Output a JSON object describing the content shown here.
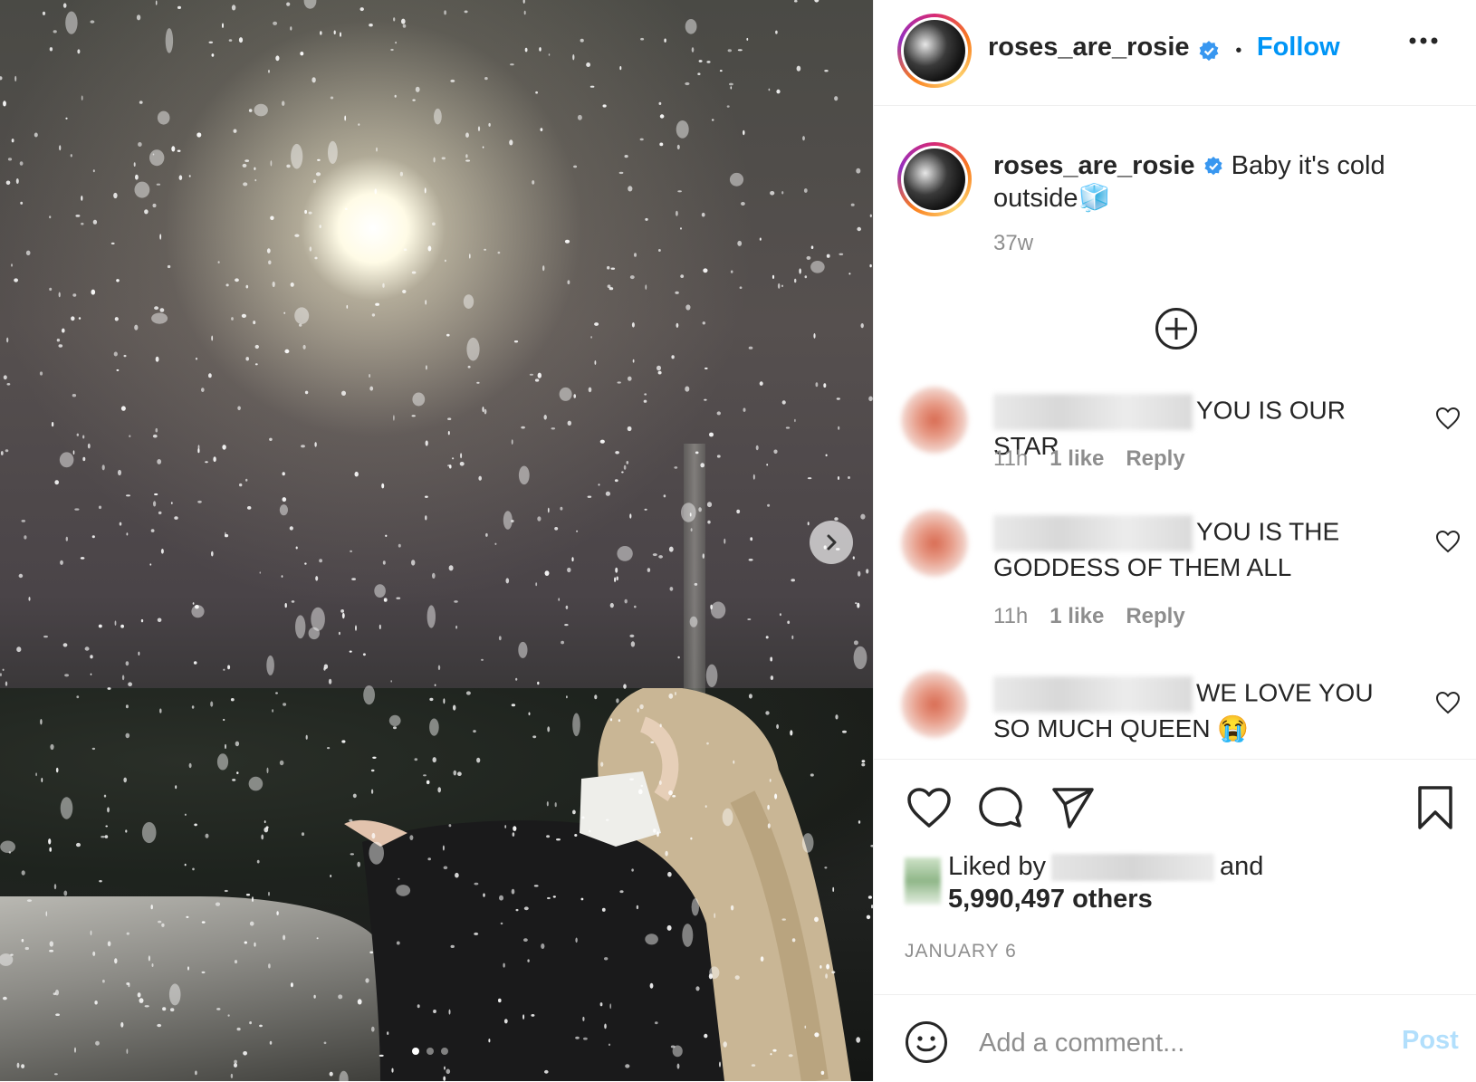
{
  "post": {
    "username": "roses_are_rosie",
    "follow_label": "Follow",
    "dot_separator": "•",
    "caption_line1": "Baby it's cold",
    "caption_line2": "outside",
    "caption_emoji": "🧊",
    "time_ago": "37w"
  },
  "comments": [
    {
      "text": "YOU IS OUR STAR",
      "time": "11h",
      "likes": "1 like",
      "reply": "Reply"
    },
    {
      "text": "YOU IS THE GODDESS OF THEM ALL",
      "time": "11h",
      "likes": "1 like",
      "reply": "Reply"
    },
    {
      "text": "WE LOVE YOU SO MUCH QUEEN 😭"
    }
  ],
  "likes": {
    "prefix": "Liked by",
    "middle": "and",
    "count": "5,990,497 others"
  },
  "date": "JANUARY 6",
  "add_comment": {
    "placeholder": "Add a comment...",
    "post_label": "Post"
  },
  "carousel": {
    "count": 3,
    "active": 0
  },
  "colors": {
    "accent": "#0095f6",
    "verified": "#3897f0",
    "post_disabled": "#b2dffc"
  }
}
